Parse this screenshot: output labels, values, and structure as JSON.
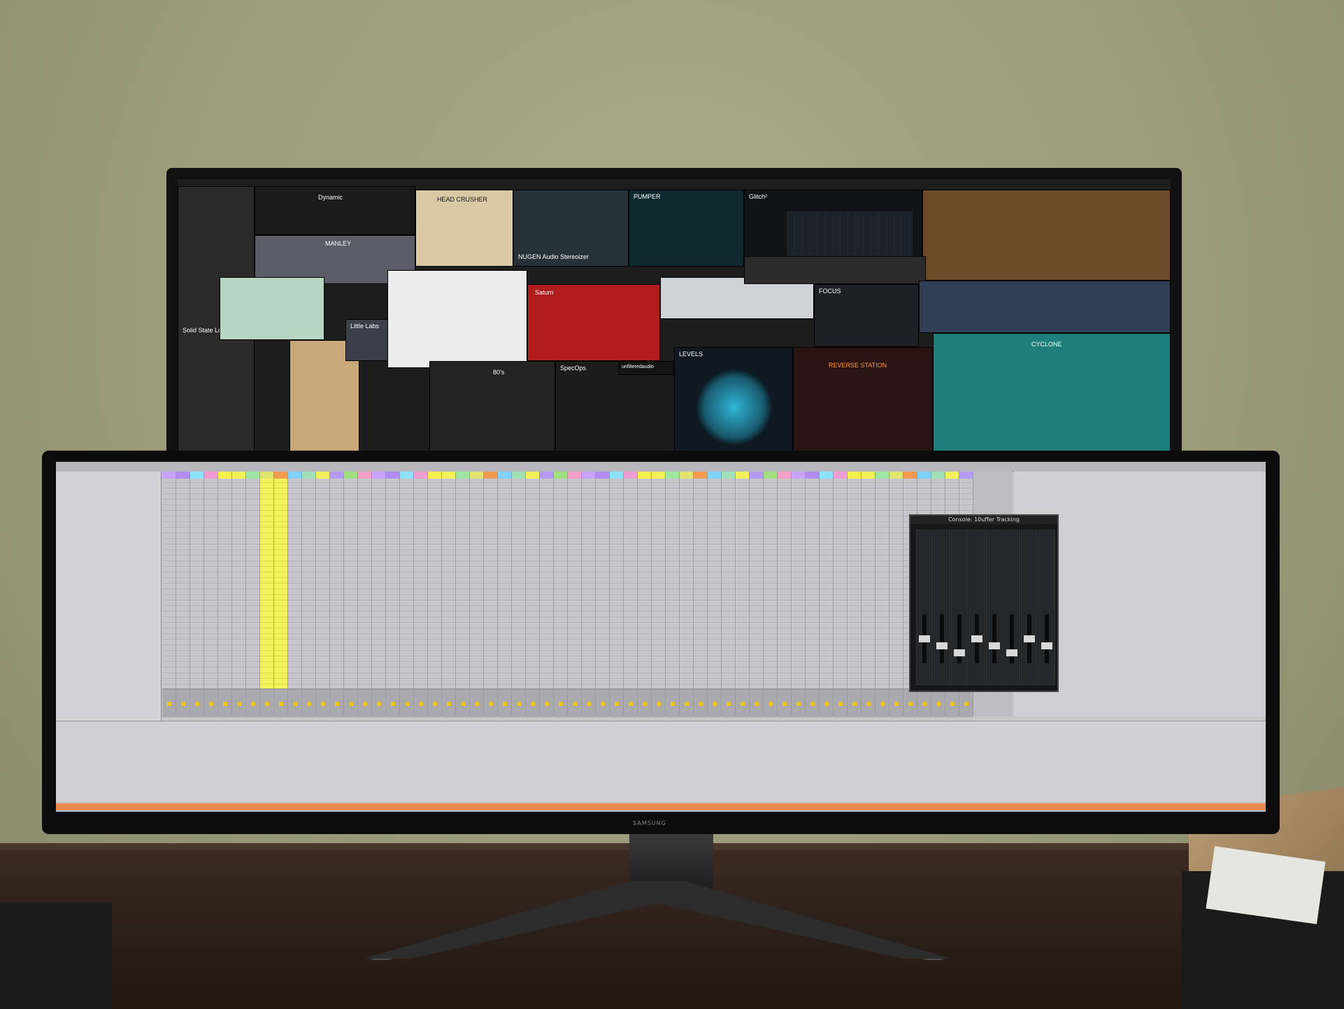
{
  "scene": {
    "upper_monitor_plugins": [
      {
        "name": "Solid State Logic",
        "color": "#2b2b2b"
      },
      {
        "name": "Dynamic",
        "color": "#1b1b1b"
      },
      {
        "name": "MANLEY",
        "color": "#5c5c68"
      },
      {
        "name": "HEAD CRUSHER",
        "color": "#d9c9a5"
      },
      {
        "name": "NUGEN Audio Stereoizer",
        "color": "#263238"
      },
      {
        "name": "PUMPER",
        "color": "#0e2a2e"
      },
      {
        "name": "Glitch²",
        "color": "#101418"
      },
      {
        "name": "Little Labs",
        "color": "#3a3f4a"
      },
      {
        "name": "Saturn",
        "color": "#b11d1d"
      },
      {
        "name": "SpecOps",
        "color": "#1c1c1c"
      },
      {
        "name": "unfilteredaudio",
        "color": "#141414"
      },
      {
        "name": "LEVELS",
        "color": "#101822"
      },
      {
        "name": "REVERSE STATION",
        "color": "#2a1313"
      },
      {
        "name": "FOCUS",
        "color": "#1d2127"
      },
      {
        "name": "CYCLONE",
        "color": "#1d7d7a"
      },
      {
        "name": "80's",
        "color": "#232323"
      }
    ],
    "lower_monitor": {
      "brand": "SAMSUNG",
      "ua_panel_title": "Console: 10uffer Tracking",
      "track_colors": [
        "#c9a1ff",
        "#b08cf0",
        "#8ce2ff",
        "#ef9dd2",
        "#f6f14a",
        "#f4f05a",
        "#9fe6a0",
        "#dfe56e",
        "#f39a52",
        "#7fd1ff",
        "#9fe0b8",
        "#f1f05b",
        "#b49af2",
        "#9fe07f",
        "#f3a0c8"
      ]
    }
  }
}
